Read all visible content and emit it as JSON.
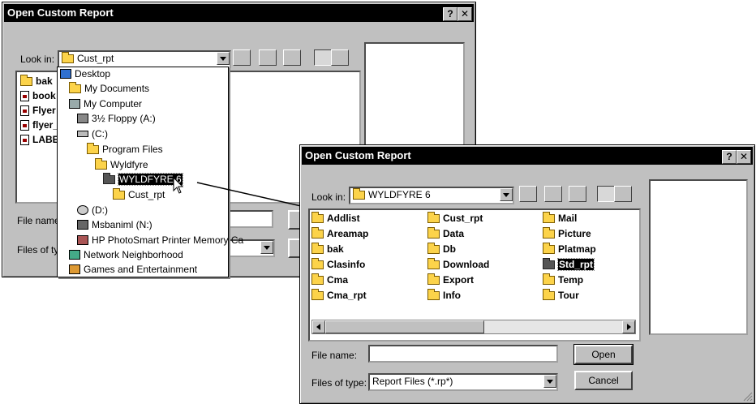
{
  "dialog_back": {
    "title": "Open Custom Report",
    "help_btn": "?",
    "close_btn": "✕",
    "look_in_label": "Look in:",
    "look_in_value": "Cust_rpt",
    "file_name_label": "File name",
    "files_of_type_label": "Files of ty",
    "files": [
      "bak",
      "book",
      "Flyer",
      "flyer_",
      "LABE"
    ]
  },
  "dropdown_menu": {
    "items": [
      {
        "label": "Desktop"
      },
      {
        "label": "My Documents"
      },
      {
        "label": "My Computer"
      },
      {
        "label": "3½ Floppy (A:)"
      },
      {
        "label": "(C:)"
      },
      {
        "label": "Program Files"
      },
      {
        "label": "Wyldfyre"
      },
      {
        "label": "WYLDFYRE 6"
      },
      {
        "label": "Cust_rpt"
      },
      {
        "label": "(D:)"
      },
      {
        "label": "Msbaniml (N:)"
      },
      {
        "label": "HP PhotoSmart Printer Memory Ca"
      },
      {
        "label": "Network Neighborhood"
      },
      {
        "label": "Games and Entertainment"
      }
    ]
  },
  "dialog_front": {
    "title": "Open Custom Report",
    "help_btn": "?",
    "close_btn": "✕",
    "look_in_label": "Look in:",
    "look_in_value": "WYLDFYRE 6",
    "file_name_label": "File name:",
    "file_name_value": "",
    "files_of_type_label": "Files of type:",
    "files_of_type_value": "Report Files (*.rp*)",
    "open_btn": "Open",
    "cancel_btn": "Cancel",
    "folders_col1": [
      "Addlist",
      "Areamap",
      "bak",
      "Clasinfo",
      "Cma",
      "Cma_rpt"
    ],
    "folders_col2": [
      "Cust_rpt",
      "Data",
      "Db",
      "Download",
      "Export",
      "Info"
    ],
    "folders_col3": [
      "Mail",
      "Picture",
      "Platmap",
      "Std_rpt",
      "Temp",
      "Tour"
    ]
  },
  "colors": {
    "dialog_face": "#c0c0c0",
    "titlebar": "#000000",
    "selection": "#000000",
    "folder": "#fcd34a"
  }
}
